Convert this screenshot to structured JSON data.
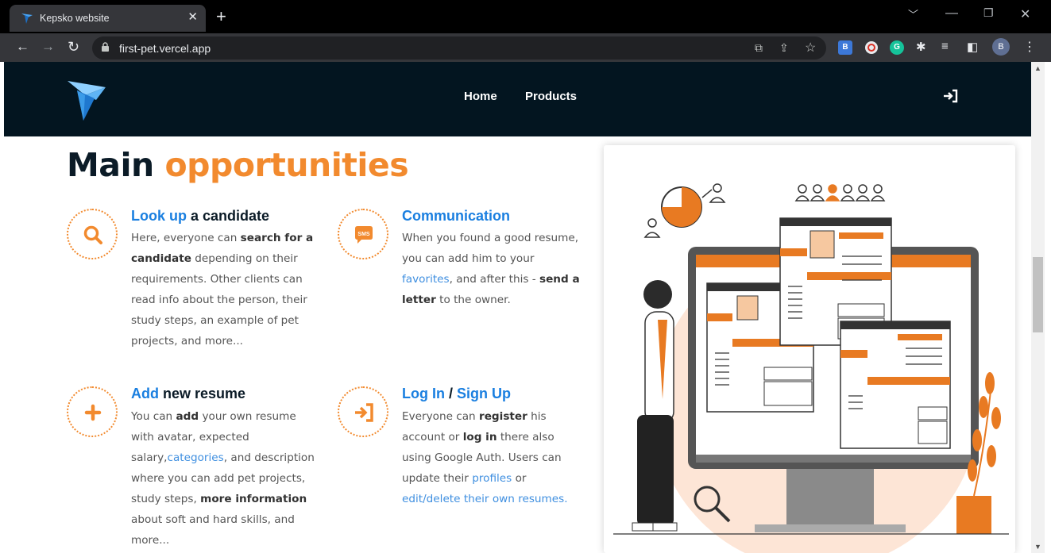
{
  "browser": {
    "tab_title": "Kepsko website",
    "url": "first-pet.vercel.app",
    "profile_initial": "B",
    "extensions": [
      {
        "name": "b-extension-icon",
        "letter": "B",
        "color": "#3c78d8"
      },
      {
        "name": "vpn-extension-icon",
        "letter": "",
        "color": "#e8eaed"
      },
      {
        "name": "grammarly-icon",
        "letter": "G",
        "color": "#15c39a"
      }
    ]
  },
  "site": {
    "nav": {
      "home": "Home",
      "products": "Products"
    }
  },
  "main": {
    "title_part1": "Main",
    "title_part2": "opportunities",
    "features": {
      "lookup": {
        "title_accent": "Look up",
        "title_rest": " a candidate",
        "body": [
          {
            "t": "Here, everyone can "
          },
          {
            "t": "search for a candidate",
            "b": true
          },
          {
            "t": " depending on their requirements. Other clients can read info about the person, their study steps, an example of pet projects, and more..."
          }
        ]
      },
      "communication": {
        "title_accent": "Communication",
        "icon_text": "SMS",
        "body": [
          {
            "t": "When you found a good resume, you can add him to your "
          },
          {
            "t": "favorites",
            "a": true
          },
          {
            "t": ", and after this - "
          },
          {
            "t": "send a letter",
            "b": true
          },
          {
            "t": " to the owner."
          }
        ]
      },
      "add": {
        "title_accent": "Add",
        "title_rest": " new resume",
        "body": [
          {
            "t": "You can "
          },
          {
            "t": "add",
            "b": true
          },
          {
            "t": " your own resume with avatar, expected salary,"
          },
          {
            "t": "categories",
            "a": true
          },
          {
            "t": ", and description where you can add pet projects, study steps, "
          },
          {
            "t": "more information",
            "b": true
          },
          {
            "t": " about soft and hard skills, and more..."
          }
        ]
      },
      "login": {
        "title_accent": "Log In",
        "title_sep": " / ",
        "title_accent2": "Sign Up",
        "body": [
          {
            "t": "Everyone can "
          },
          {
            "t": "register",
            "b": true
          },
          {
            "t": " his account or "
          },
          {
            "t": "log in",
            "b": true
          },
          {
            "t": " there also using Google Auth. Users can update their "
          },
          {
            "t": "profiles",
            "a": true
          },
          {
            "t": " or "
          },
          {
            "t": "edit/delete their own resumes.",
            "a": true
          }
        ]
      }
    }
  },
  "colors": {
    "accent": "#f28a2e",
    "link": "#1a7fe0",
    "header_bg": "#031520"
  }
}
